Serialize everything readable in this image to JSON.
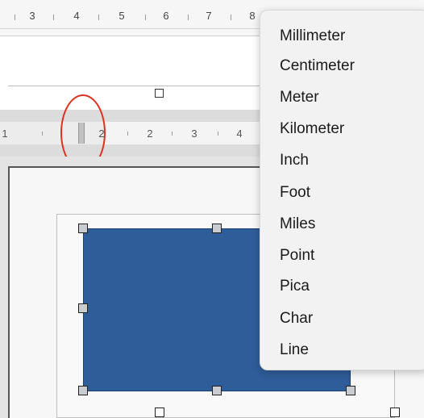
{
  "top_ruler": {
    "numbers": [
      "3",
      "4",
      "5",
      "6",
      "7",
      "8"
    ]
  },
  "second_ruler": {
    "numbers": [
      "1",
      "2",
      "3",
      "4"
    ]
  },
  "unit_menu": {
    "items": [
      "Millimeter",
      "Centimeter",
      "Meter",
      "Kilometer",
      "Inch",
      "Foot",
      "Miles",
      "Point",
      "Pica",
      "Char",
      "Line"
    ]
  },
  "shape": {
    "fill_color": "#2f5d9a"
  },
  "annotation": {
    "color": "#e0301f"
  }
}
